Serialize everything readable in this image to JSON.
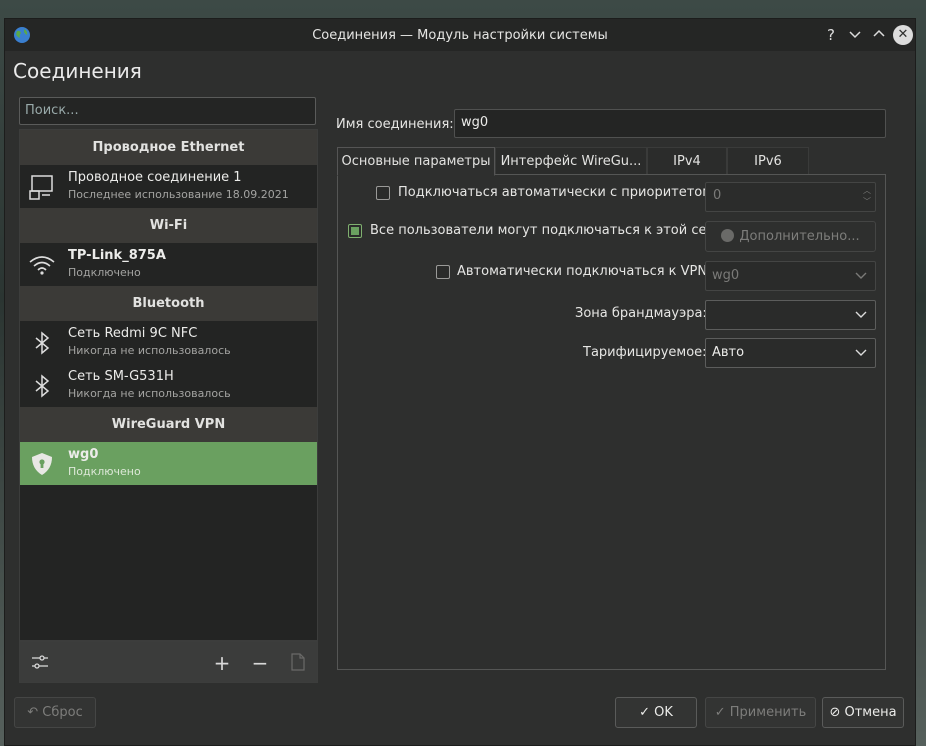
{
  "window": {
    "title": "Соединения — Модуль настройки системы"
  },
  "titlebar_buttons": {
    "help": "?",
    "minimize": "⌄",
    "maximize": "⌃",
    "close": "✕"
  },
  "page_title": "Соединения",
  "search": {
    "placeholder": "Поиск..."
  },
  "groups": [
    {
      "header": "Проводное Ethernet",
      "items": [
        {
          "name": "Проводное соединение 1",
          "sub": "Последнее использование 18.09.2021",
          "icon": "monitor-icon"
        }
      ]
    },
    {
      "header": "Wi-Fi",
      "items": [
        {
          "name": "TP-Link_875A",
          "sub": "Подключено",
          "icon": "wifi-icon"
        }
      ]
    },
    {
      "header": "Bluetooth",
      "items": [
        {
          "name": "Сеть Redmi 9C NFC",
          "sub": "Никогда не использовалось",
          "icon": "bluetooth-icon"
        },
        {
          "name": "Сеть SM-G531H",
          "sub": "Никогда не использовалось",
          "icon": "bluetooth-icon"
        }
      ]
    },
    {
      "header": "WireGuard VPN",
      "items": [
        {
          "name": "wg0",
          "sub": "Подключено",
          "icon": "shield-lock-icon",
          "selected": true
        }
      ]
    }
  ],
  "list_toolbar": {
    "configure": "sliders-icon",
    "add": "+",
    "remove": "−",
    "export": "export-icon"
  },
  "form": {
    "name_label": "Имя соединения:",
    "name_value": "wg0",
    "tabs": [
      "Основные параметры",
      "Интерфейс WireGu...",
      "IPv4",
      "IPv6"
    ],
    "auto_connect_label": "Подключаться автоматически с приоритетом:",
    "priority_value": "0",
    "all_users_label": "Все пользователи могут подключаться к этой сети",
    "advanced_button": "Дополнительно...",
    "auto_vpn_label": "Автоматически подключаться к VPN:",
    "vpn_value": "wg0",
    "firewall_label": "Зона брандмауэра:",
    "firewall_value": "",
    "metered_label": "Тарифицируемое:",
    "metered_value": "Авто"
  },
  "footer": {
    "reset": "Сброс",
    "ok": "OK",
    "apply": "Применить",
    "cancel": "Отмена"
  },
  "colors": {
    "accent": "#6aa060",
    "background": "#2e2f2e",
    "group_header": "#3b3a37"
  }
}
